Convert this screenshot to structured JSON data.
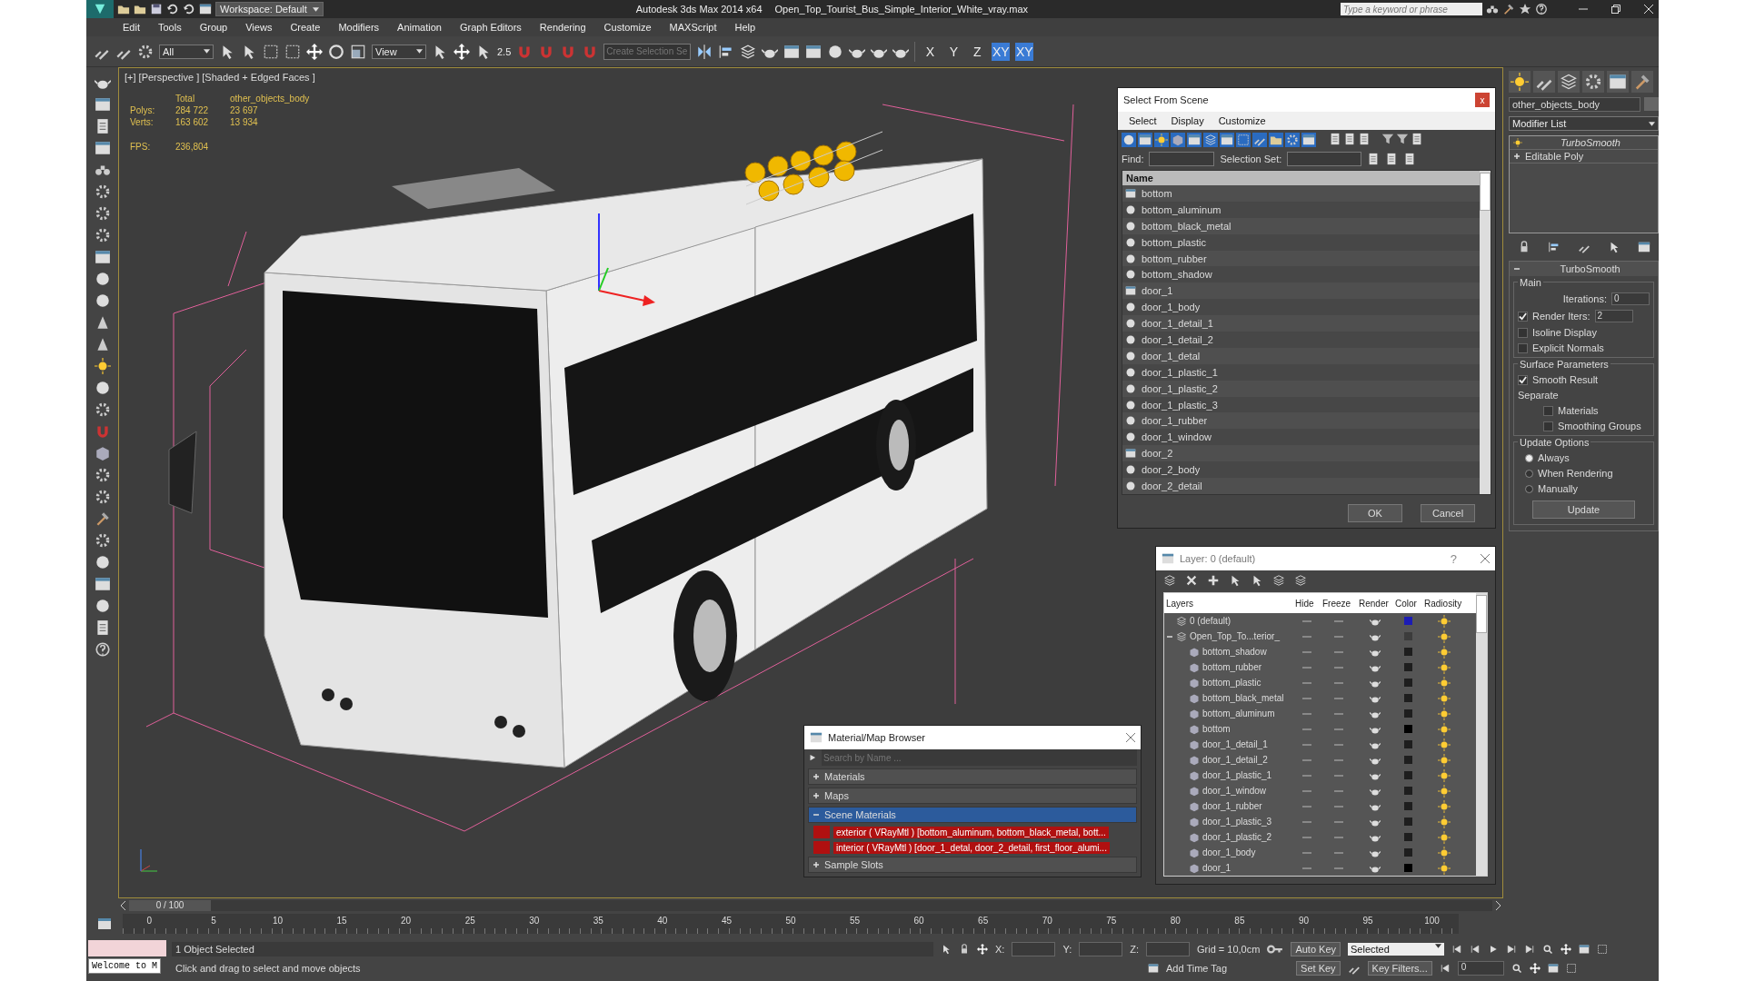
{
  "title_bar": {
    "workspace": "Workspace: Default",
    "app": "Autodesk 3ds Max  2014 x64",
    "file": "Open_Top_Tourist_Bus_Simple_Interior_White_vray.max",
    "search": {
      "placeholder": "Type a keyword or phrase"
    }
  },
  "menu": [
    "Edit",
    "Tools",
    "Group",
    "Views",
    "Create",
    "Modifiers",
    "Animation",
    "Graph Editors",
    "Rendering",
    "Customize",
    "MAXScript",
    "Help"
  ],
  "toolbar": {
    "selection_filter": "All",
    "reference_coord": "View",
    "snap_text": "2.5",
    "selection_set": {
      "placeholder": "Create Selection Se"
    },
    "axis_buttons": [
      {
        "label": "X",
        "selected": false
      },
      {
        "label": "Y",
        "selected": false
      },
      {
        "label": "Z",
        "selected": false
      },
      {
        "label": "XY",
        "selected": true
      },
      {
        "label": "XY",
        "selected": true
      }
    ]
  },
  "viewport": {
    "label": "[+] [Perspective ] [Shaded + Edged Faces ]",
    "stats": {
      "header": [
        "Total",
        "other_objects_body"
      ],
      "rows": [
        {
          "label": "Polys:",
          "total": "284 722",
          "object": "23 697"
        },
        {
          "label": "Verts:",
          "total": "163 602",
          "object": "13 934"
        }
      ],
      "fps": {
        "label": "FPS:",
        "value": "236,804"
      }
    }
  },
  "select_dialog": {
    "title": "Select From Scene",
    "close": "x",
    "menu": [
      "Select",
      "Display",
      "Customize"
    ],
    "find_label": "Find:",
    "selection_set_label": "Selection Set:",
    "column": "Name",
    "items": [
      {
        "name": "bottom",
        "kind": "group"
      },
      {
        "name": "bottom_aluminum",
        "kind": "object"
      },
      {
        "name": "bottom_black_metal",
        "kind": "object"
      },
      {
        "name": "bottom_plastic",
        "kind": "object"
      },
      {
        "name": "bottom_rubber",
        "kind": "object"
      },
      {
        "name": "bottom_shadow",
        "kind": "object"
      },
      {
        "name": "door_1",
        "kind": "group"
      },
      {
        "name": "door_1_body",
        "kind": "object"
      },
      {
        "name": "door_1_detail_1",
        "kind": "object"
      },
      {
        "name": "door_1_detail_2",
        "kind": "object"
      },
      {
        "name": "door_1_detal",
        "kind": "object"
      },
      {
        "name": "door_1_plastic_1",
        "kind": "object"
      },
      {
        "name": "door_1_plastic_2",
        "kind": "object"
      },
      {
        "name": "door_1_plastic_3",
        "kind": "object"
      },
      {
        "name": "door_1_rubber",
        "kind": "object"
      },
      {
        "name": "door_1_window",
        "kind": "object"
      },
      {
        "name": "door_2",
        "kind": "group"
      },
      {
        "name": "door_2_body",
        "kind": "object"
      },
      {
        "name": "door_2_detail",
        "kind": "object"
      }
    ],
    "buttons": [
      "OK",
      "Cancel"
    ]
  },
  "layer_dialog": {
    "title": "Layer: 0 (default)",
    "help": "?",
    "columns": [
      "Layers",
      "Hide",
      "Freeze",
      "Render",
      "Color",
      "Radiosity"
    ],
    "layers": [
      {
        "name": "0 (default)",
        "color": "#1c1cb4"
      },
      {
        "name": "Open_Top_To...terior_",
        "color": "#3c3c3c",
        "expanded": true,
        "children": [
          {
            "name": "bottom_shadow",
            "color": "#1e1e1e"
          },
          {
            "name": "bottom_rubber",
            "color": "#1e1e1e"
          },
          {
            "name": "bottom_plastic",
            "color": "#1e1e1e"
          },
          {
            "name": "bottom_black_metal",
            "color": "#1e1e1e"
          },
          {
            "name": "bottom_aluminum",
            "color": "#1e1e1e"
          },
          {
            "name": "bottom",
            "color": "#000000"
          },
          {
            "name": "door_1_detail_1",
            "color": "#1e1e1e"
          },
          {
            "name": "door_1_detail_2",
            "color": "#1e1e1e"
          },
          {
            "name": "door_1_plastic_1",
            "color": "#1e1e1e"
          },
          {
            "name": "door_1_window",
            "color": "#1e1e1e"
          },
          {
            "name": "door_1_rubber",
            "color": "#1e1e1e"
          },
          {
            "name": "door_1_plastic_3",
            "color": "#1e1e1e"
          },
          {
            "name": "door_1_plastic_2",
            "color": "#1e1e1e"
          },
          {
            "name": "door_1_body",
            "color": "#1e1e1e"
          },
          {
            "name": "door_1",
            "color": "#000000"
          }
        ]
      }
    ]
  },
  "material_browser": {
    "title": "Material/Map Browser",
    "search": {
      "placeholder": "Search by Name ..."
    },
    "groups": [
      {
        "label": "Materials",
        "expanded": false,
        "selected": false
      },
      {
        "label": "Maps",
        "expanded": false,
        "selected": false
      },
      {
        "label": "Scene Materials",
        "expanded": true,
        "selected": true,
        "items": [
          "exterior  ( VRayMtl ) [bottom_aluminum, bottom_black_metal, bott...",
          "interior  ( VRayMtl ) [door_1_detal, door_2_detail, first_floor_alumi..."
        ]
      },
      {
        "label": "Sample Slots",
        "expanded": false,
        "selected": false
      }
    ]
  },
  "command_panel": {
    "object_name": "other_objects_body",
    "modifier_list": "Modifier List",
    "stack": [
      {
        "name": "TurboSmooth",
        "kind": "modifier"
      },
      {
        "name": "Editable Poly",
        "kind": "base"
      }
    ],
    "rollout": {
      "title": "TurboSmooth",
      "main_label": "Main",
      "iterations": {
        "label": "Iterations:",
        "value": "0"
      },
      "render_iters": {
        "label": "Render Iters:",
        "value": "2",
        "checked": true
      },
      "options": [
        {
          "label": "Isoline Display",
          "checked": false
        },
        {
          "label": "Explicit Normals",
          "checked": false
        }
      ],
      "surface_label": "Surface Parameters",
      "smooth_result": {
        "label": "Smooth Result",
        "checked": true
      },
      "separate": "Separate",
      "separate_options": [
        {
          "label": "Materials",
          "checked": false
        },
        {
          "label": "Smoothing Groups",
          "checked": false
        }
      ],
      "update_label": "Update Options",
      "modes": [
        {
          "label": "Always",
          "selected": true
        },
        {
          "label": "When Rendering",
          "selected": false
        },
        {
          "label": "Manually",
          "selected": false
        }
      ],
      "update_button": "Update"
    }
  },
  "timeline": {
    "position": "0 / 100",
    "ticks": [
      "0",
      "5",
      "10",
      "15",
      "20",
      "25",
      "30",
      "35",
      "40",
      "45",
      "50",
      "55",
      "60",
      "65",
      "70",
      "75",
      "80",
      "85",
      "90",
      "95",
      "100"
    ]
  },
  "status": {
    "welcome": "Welcome to M",
    "selection": "1 Object Selected",
    "prompt": "Click and drag to select and move objects",
    "coords": [
      "X:",
      "Y:",
      "Z:"
    ],
    "grid": "Grid = 10,0cm",
    "add_time_tag": "Add Time Tag",
    "auto_key": "Auto Key",
    "key_mode": "Selected",
    "set_key": "Set Key",
    "key_filters": "Key Filters...",
    "frame": "0"
  }
}
